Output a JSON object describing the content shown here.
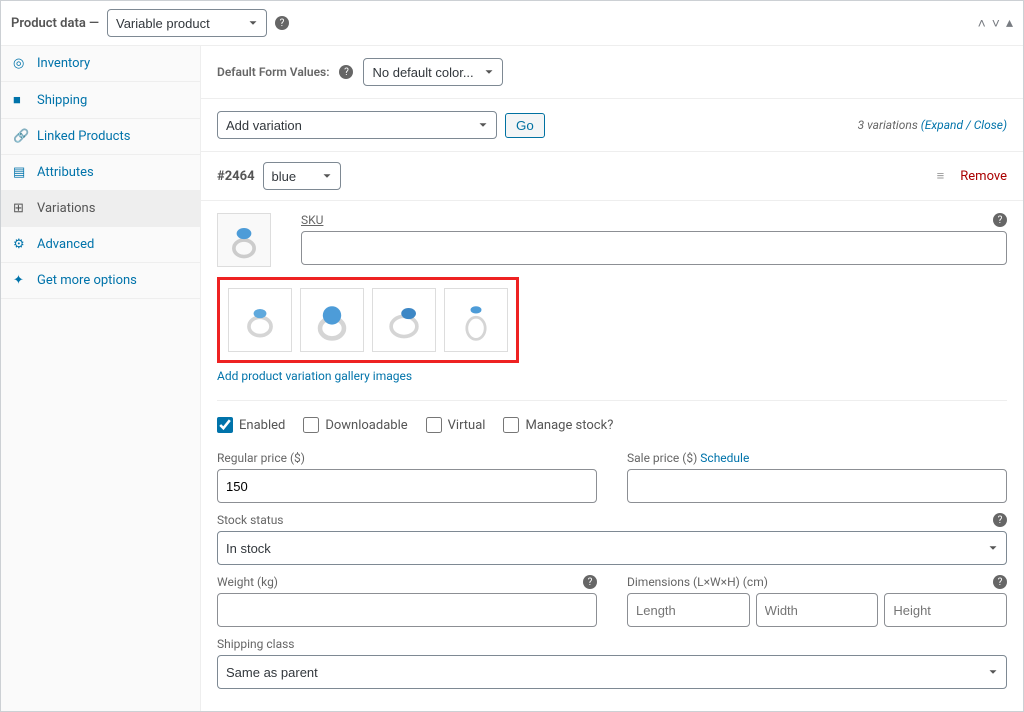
{
  "header": {
    "title": "Product data —",
    "product_type": "Variable product"
  },
  "sidebar": {
    "items": [
      {
        "label": "Inventory",
        "icon": "inventory"
      },
      {
        "label": "Shipping",
        "icon": "shipping"
      },
      {
        "label": "Linked Products",
        "icon": "linked"
      },
      {
        "label": "Attributes",
        "icon": "attributes"
      },
      {
        "label": "Variations",
        "icon": "variations",
        "active": true
      },
      {
        "label": "Advanced",
        "icon": "advanced"
      },
      {
        "label": "Get more options",
        "icon": "more"
      }
    ]
  },
  "default_form": {
    "label": "Default Form Values:",
    "selected": "No default color..."
  },
  "toolbar": {
    "add_variation": "Add variation",
    "go": "Go",
    "count_text": "3 variations",
    "expand_close": "(Expand / Close)"
  },
  "variation": {
    "id": "#2464",
    "color_selected": "blue",
    "remove": "Remove",
    "add_gallery": "Add product variation gallery images",
    "checkboxes": {
      "enabled": "Enabled",
      "downloadable": "Downloadable",
      "virtual": "Virtual",
      "manage_stock": "Manage stock?"
    },
    "fields": {
      "sku_label": "SKU",
      "sku_value": "",
      "regular_price_label": "Regular price ($)",
      "regular_price_value": "150",
      "sale_price_label": "Sale price ($)",
      "schedule": "Schedule",
      "sale_price_value": "",
      "stock_status_label": "Stock status",
      "stock_status_value": "In stock",
      "weight_label": "Weight (kg)",
      "weight_value": "",
      "dimensions_label": "Dimensions (L×W×H) (cm)",
      "length_placeholder": "Length",
      "width_placeholder": "Width",
      "height_placeholder": "Height",
      "shipping_class_label": "Shipping class",
      "shipping_class_value": "Same as parent"
    }
  }
}
